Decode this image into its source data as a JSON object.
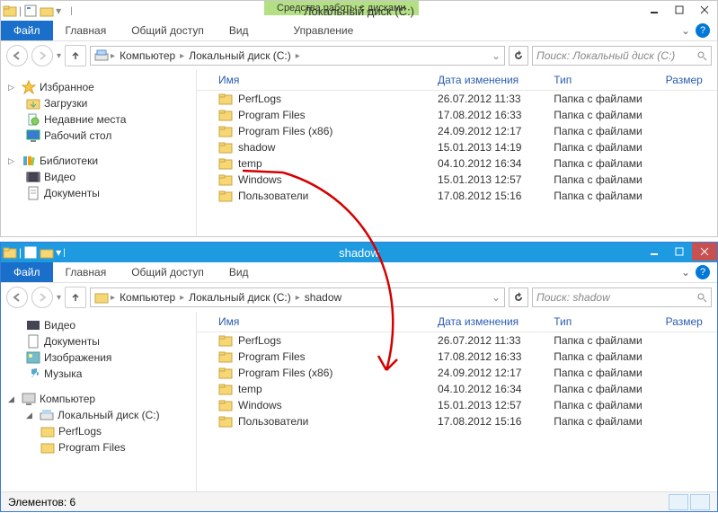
{
  "window1": {
    "context_tab": "Средства работы с дисками",
    "title": "Локальный диск (C:)",
    "menubar": {
      "file": "Файл",
      "tabs": [
        "Главная",
        "Общий доступ",
        "Вид",
        "Управление"
      ]
    },
    "breadcrumb": [
      "Компьютер",
      "Локальный диск (C:)"
    ],
    "search_placeholder": "Поиск: Локальный диск (C:)",
    "nav": {
      "favorites": {
        "label": "Избранное",
        "items": [
          "Загрузки",
          "Недавние места",
          "Рабочий стол"
        ]
      },
      "libraries": {
        "label": "Библиотеки",
        "items": [
          "Видео",
          "Документы"
        ]
      }
    },
    "columns": {
      "name": "Имя",
      "date": "Дата изменения",
      "type": "Тип",
      "size": "Размер"
    },
    "files": [
      {
        "name": "PerfLogs",
        "date": "26.07.2012 11:33",
        "type": "Папка с файлами"
      },
      {
        "name": "Program Files",
        "date": "17.08.2012 16:33",
        "type": "Папка с файлами"
      },
      {
        "name": "Program Files (x86)",
        "date": "24.09.2012 12:17",
        "type": "Папка с файлами"
      },
      {
        "name": "shadow",
        "date": "15.01.2013 14:19",
        "type": "Папка с файлами"
      },
      {
        "name": "temp",
        "date": "04.10.2012 16:34",
        "type": "Папка с файлами"
      },
      {
        "name": "Windows",
        "date": "15.01.2013 12:57",
        "type": "Папка с файлами"
      },
      {
        "name": "Пользователи",
        "date": "17.08.2012 15:16",
        "type": "Папка с файлами"
      }
    ]
  },
  "window2": {
    "title": "shadow",
    "menubar": {
      "file": "Файл",
      "tabs": [
        "Главная",
        "Общий доступ",
        "Вид"
      ]
    },
    "breadcrumb": [
      "Компьютер",
      "Локальный диск (C:)",
      "shadow"
    ],
    "search_placeholder": "Поиск: shadow",
    "nav": {
      "libraries_extra": [
        "Видео",
        "Документы",
        "Изображения",
        "Музыка"
      ],
      "computer": {
        "label": "Компьютер",
        "drive": "Локальный диск (C:)",
        "folders": [
          "PerfLogs",
          "Program Files"
        ]
      }
    },
    "columns": {
      "name": "Имя",
      "date": "Дата изменения",
      "type": "Тип",
      "size": "Размер"
    },
    "files": [
      {
        "name": "PerfLogs",
        "date": "26.07.2012 11:33",
        "type": "Папка с файлами"
      },
      {
        "name": "Program Files",
        "date": "17.08.2012 16:33",
        "type": "Папка с файлами"
      },
      {
        "name": "Program Files (x86)",
        "date": "24.09.2012 12:17",
        "type": "Папка с файлами"
      },
      {
        "name": "temp",
        "date": "04.10.2012 16:34",
        "type": "Папка с файлами"
      },
      {
        "name": "Windows",
        "date": "15.01.2013 12:57",
        "type": "Папка с файлами"
      },
      {
        "name": "Пользователи",
        "date": "17.08.2012 15:16",
        "type": "Папка с файлами"
      }
    ],
    "status": "Элементов: 6"
  }
}
